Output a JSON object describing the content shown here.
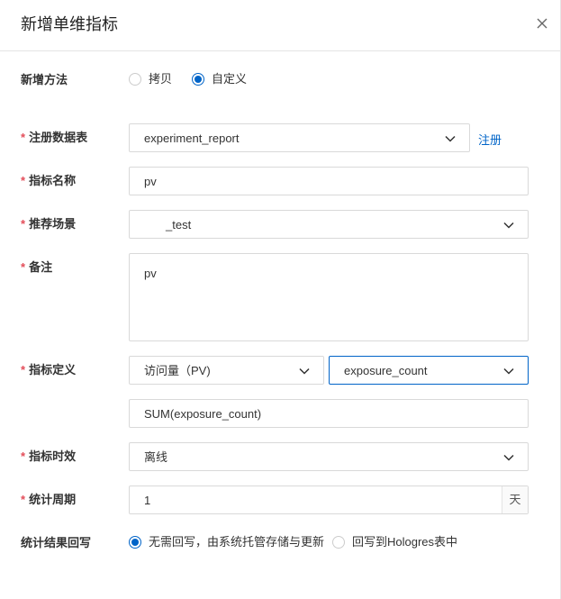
{
  "dialog": {
    "title": "新增单维指标"
  },
  "form": {
    "method": {
      "label": "新增方法",
      "options": [
        "拷贝",
        "自定义"
      ],
      "selected": "自定义"
    },
    "table": {
      "label": "注册数据表",
      "value": "experiment_report",
      "register_link": "注册"
    },
    "name": {
      "label": "指标名称",
      "value": "pv"
    },
    "scene": {
      "label": "推荐场景",
      "value": "_test"
    },
    "note": {
      "label": "备注",
      "value": "pv"
    },
    "definition": {
      "label": "指标定义",
      "metric": "访问量（PV)",
      "field": "exposure_count",
      "expression": "SUM(exposure_count)"
    },
    "timeliness": {
      "label": "指标时效",
      "value": "离线"
    },
    "period": {
      "label": "统计周期",
      "value": "1",
      "unit": "天"
    },
    "writeback": {
      "label": "统计结果回写",
      "options": [
        "无需回写，由系统托管存储与更新",
        "回写到Hologres表中"
      ],
      "selected": "无需回写，由系统托管存储与更新"
    }
  },
  "icons": {
    "close": "close-icon",
    "dropdown": "chevron-down-icon",
    "radio": "radio-icon"
  },
  "colors": {
    "primary": "#0064c8",
    "required": "#e34d59",
    "border": "#d9d9d9"
  }
}
